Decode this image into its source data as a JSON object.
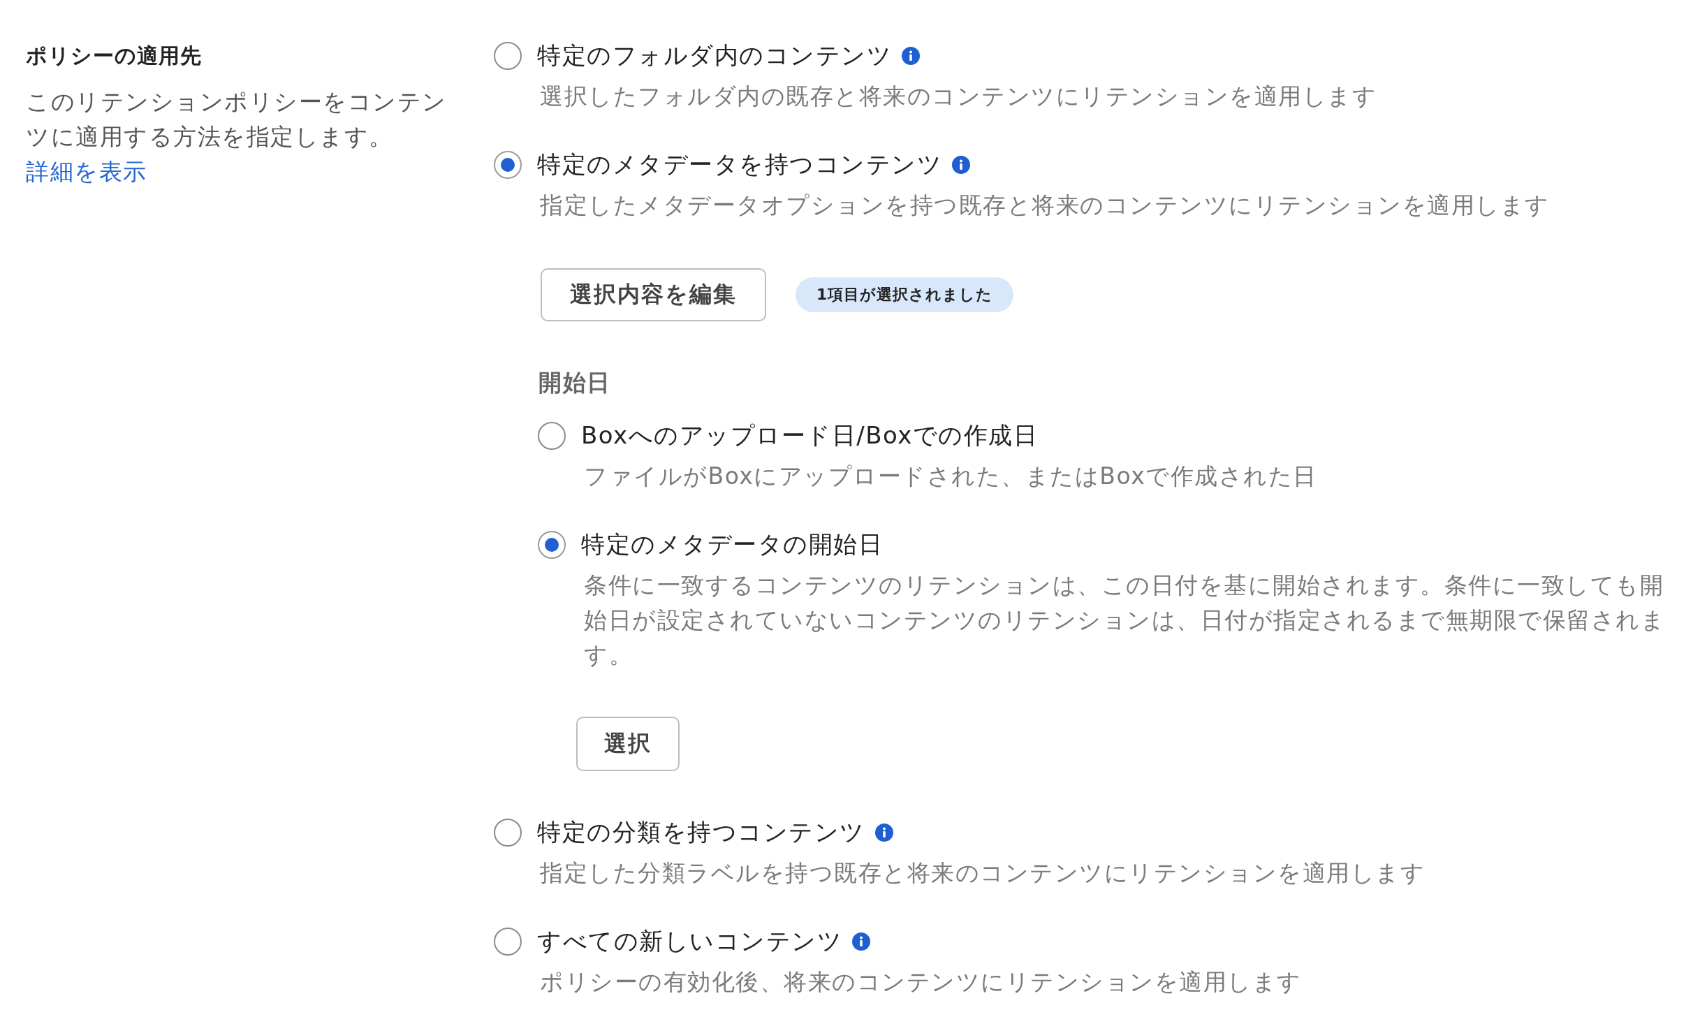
{
  "section": {
    "title": "ポリシーの適用先",
    "description": "このリテンションポリシーをコンテンツに適用する方法を指定します。",
    "link": "詳細を表示"
  },
  "options": [
    {
      "label": "特定のフォルダ内のコンテンツ",
      "description": "選択したフォルダ内の既存と将来のコンテンツにリテンションを適用します",
      "selected": false
    },
    {
      "label": "特定のメタデータを持つコンテンツ",
      "description": "指定したメタデータオプションを持つ既存と将来のコンテンツにリテンションを適用します",
      "selected": true,
      "edit_button": "選択内容を編集",
      "badge": "1項目が選択されました",
      "start_date": {
        "label": "開始日",
        "options": [
          {
            "label": "Boxへのアップロード日/Boxでの作成日",
            "description": "ファイルがBoxにアップロードされた、またはBoxで作成された日",
            "selected": false
          },
          {
            "label": "特定のメタデータの開始日",
            "description": "条件に一致するコンテンツのリテンションは、この日付を基に開始されます。条件に一致しても開始日が設定されていないコンテンツのリテンションは、日付が指定されるまで無期限で保留されます。",
            "selected": true,
            "button": "選択"
          }
        ]
      }
    },
    {
      "label": "特定の分類を持つコンテンツ",
      "description": "指定した分類ラベルを持つ既存と将来のコンテンツにリテンションを適用します",
      "selected": false
    },
    {
      "label": "すべての新しいコンテンツ",
      "description": "ポリシーの有効化後、将来のコンテンツにリテンションを適用します",
      "selected": false
    }
  ]
}
